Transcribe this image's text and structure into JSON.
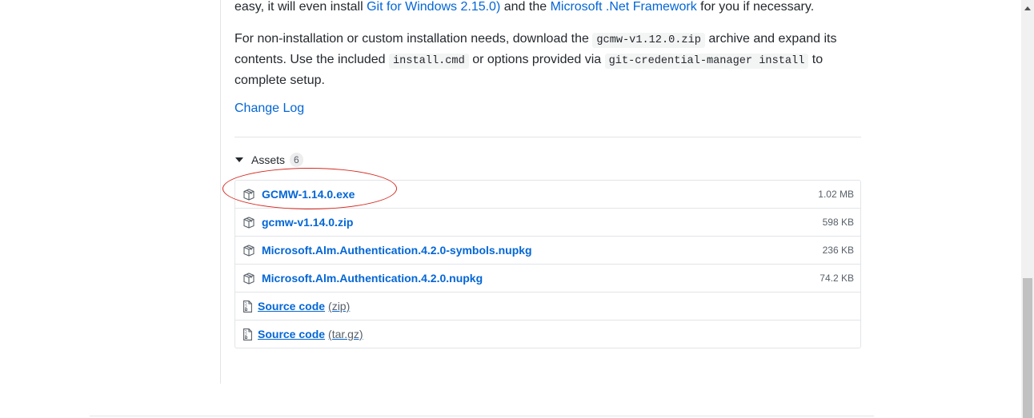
{
  "release_body": {
    "intro_prefix": "easy, it will even install ",
    "git_link": "Git for Windows 2.15.0)",
    "intro_middle": " and the ",
    "net_link": "Microsoft .Net Framework",
    "intro_suffix": " for you if necessary.",
    "p2_a": "For non-installation or custom installation needs, download the ",
    "p2_code1": "gcmw-v1.12.0.zip",
    "p2_b": " archive and expand its contents. Use the included ",
    "p2_code2": "install.cmd",
    "p2_c": " or options provided via ",
    "p2_code3": "git-credential-manager install",
    "p2_d": " to complete setup.",
    "changelog": "Change Log"
  },
  "assets": {
    "title": "Assets",
    "count": "6",
    "items": [
      {
        "name": "GCMW-1.14.0.exe",
        "size": "1.02 MB",
        "icon": "package-icon"
      },
      {
        "name": "gcmw-v1.14.0.zip",
        "size": "598 KB",
        "icon": "package-icon"
      },
      {
        "name": "Microsoft.Alm.Authentication.4.2.0-symbols.nupkg",
        "size": "236 KB",
        "icon": "package-icon"
      },
      {
        "name": "Microsoft.Alm.Authentication.4.2.0.nupkg",
        "size": "74.2 KB",
        "icon": "package-icon"
      }
    ],
    "source": [
      {
        "label": "Source code",
        "suffix": "(zip)",
        "icon": "file-zip-icon"
      },
      {
        "label": "Source code",
        "suffix": "(tar.gz)",
        "icon": "file-zip-icon"
      }
    ]
  },
  "annotation": {
    "color": "#d62a20"
  },
  "colors": {
    "link": "#0366d6",
    "muted": "#586069",
    "border": "#e1e4e8"
  }
}
